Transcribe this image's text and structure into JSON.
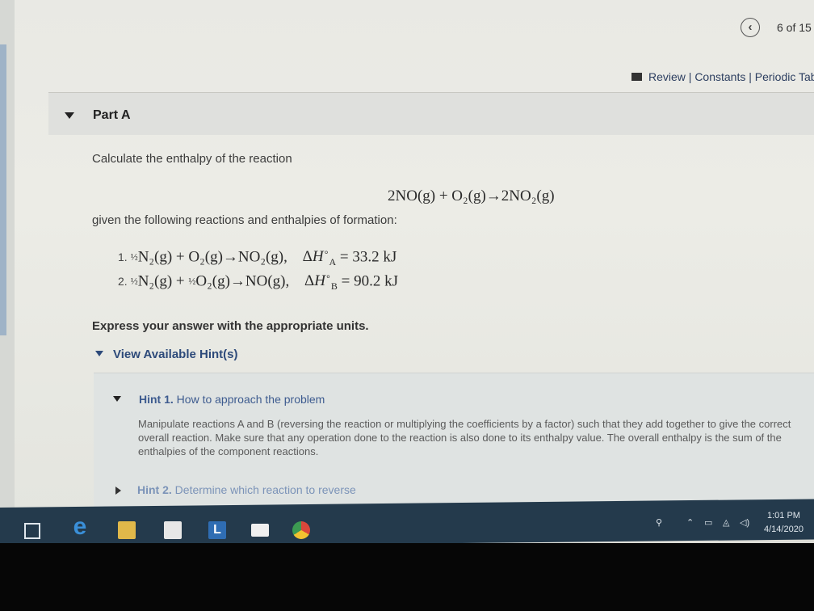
{
  "header": {
    "nav_back": "‹",
    "page_count": "6 of 15",
    "links": "Review | Constants | Periodic Table"
  },
  "part": {
    "title": "Part A"
  },
  "question": {
    "intro": "Calculate the enthalpy of the reaction",
    "main_reaction": "2NO(g) + O₂(g)→2NO₂(g)",
    "given": "given the following reactions and enthalpies of formation:",
    "reactions": [
      {
        "num": "1.",
        "eq": "N₂(g) + O₂(g)→NO₂(g),",
        "dh": "= 33.2 kJ",
        "letter": "A"
      },
      {
        "num": "2.",
        "eq": "N₂(g) + ",
        "eq2": "O₂(g)→NO(g),",
        "dh": "= 90.2 kJ",
        "letter": "B"
      }
    ],
    "express": "Express your answer with the appropriate units."
  },
  "hints": {
    "toggle_label": "View Available Hint(s)",
    "hint1_label": "Hint 1.",
    "hint1_title": "How to approach the problem",
    "hint1_body": "Manipulate reactions A and B (reversing the reaction or multiplying the coefficients by a factor) such that they add together to give the correct overall reaction. Make sure that any operation done to the reaction is also done to its enthalpy value. The overall enthalpy is the sum of the enthalpies of the component reactions.",
    "hint2_label": "Hint 2.",
    "hint2_title": "Determine which reaction to reverse"
  },
  "taskbar": {
    "time": "1:01 PM",
    "date": "4/14/2020",
    "colors": {
      "bar": "#243a4c",
      "accent": "#2f6db3"
    },
    "icons": [
      "task-view-icon",
      "edge-icon",
      "file-explorer-icon",
      "store-icon",
      "l-app-icon",
      "mail-icon",
      "chrome-icon"
    ]
  }
}
